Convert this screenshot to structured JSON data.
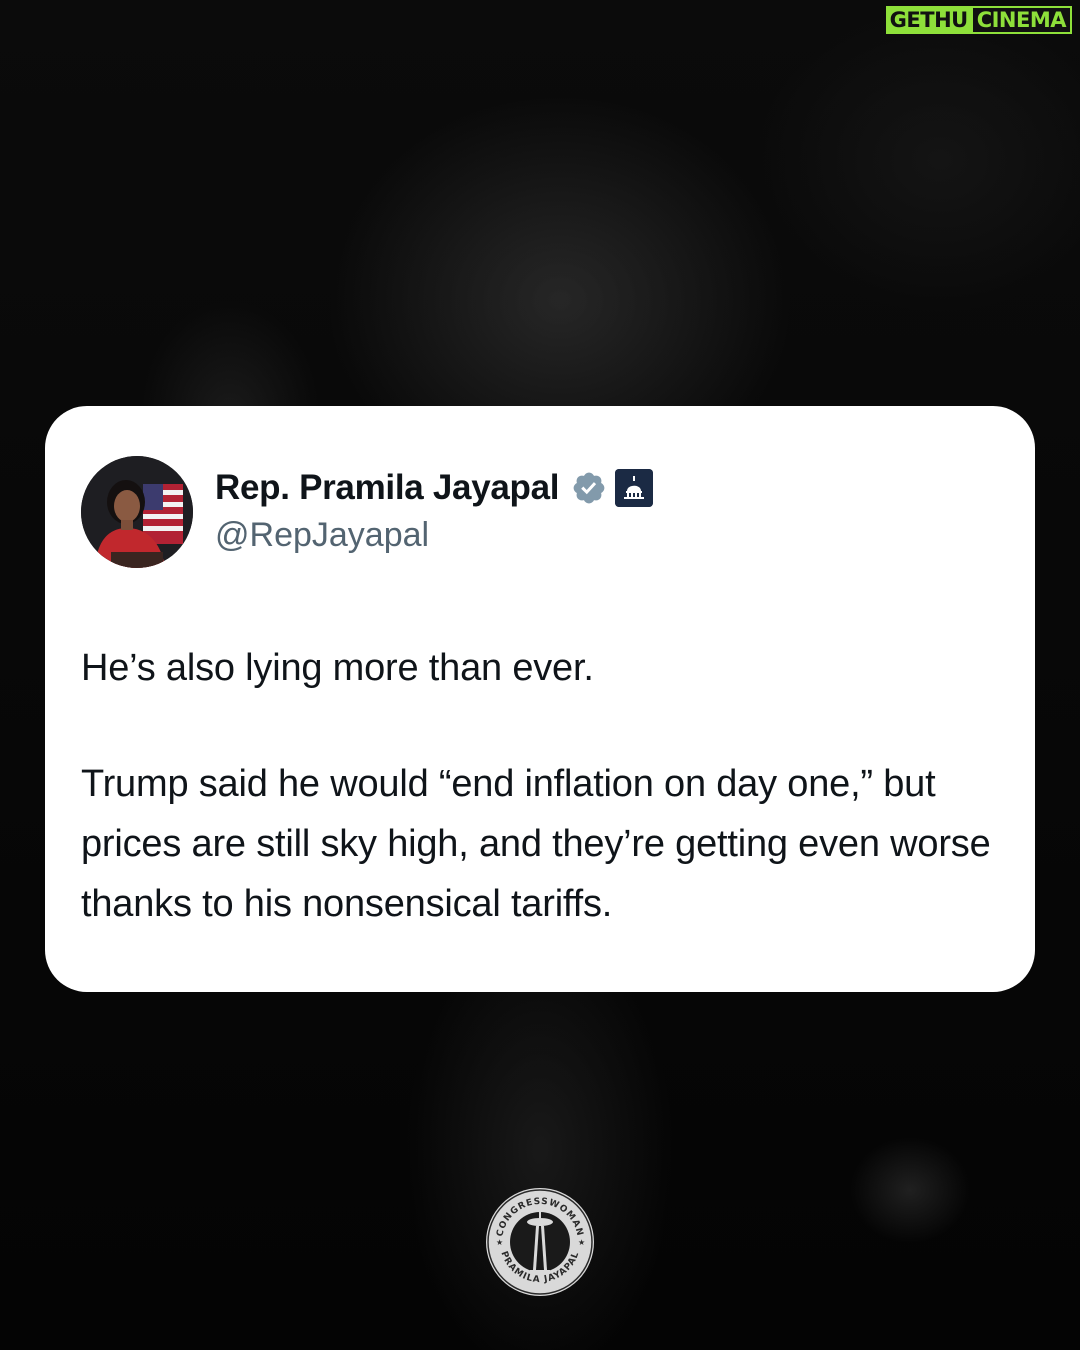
{
  "watermark": {
    "part_a": "GETHU",
    "part_b": "CINEMA",
    "accent_color": "#8ee03a"
  },
  "tweet": {
    "display_name": "Rep. Pramila Jayapal",
    "handle": "@RepJayapal",
    "verified_icon": "verified-badge-icon",
    "affiliation_icon": "capitol-icon",
    "paragraphs": [
      "He’s also lying more than ever.",
      "Trump said he would “end inflation on day one,” but prices are still sky high, and they’re getting even worse thanks to his nonsensical tariffs."
    ]
  },
  "seal": {
    "top_text": "CONGRESSWOMAN",
    "bottom_text": "PRAMILA JAYAPAL",
    "icon": "space-needle-icon"
  },
  "colors": {
    "text": "#0f1419",
    "handle": "#536471",
    "verified": "#829aab",
    "card": "#ffffff"
  }
}
